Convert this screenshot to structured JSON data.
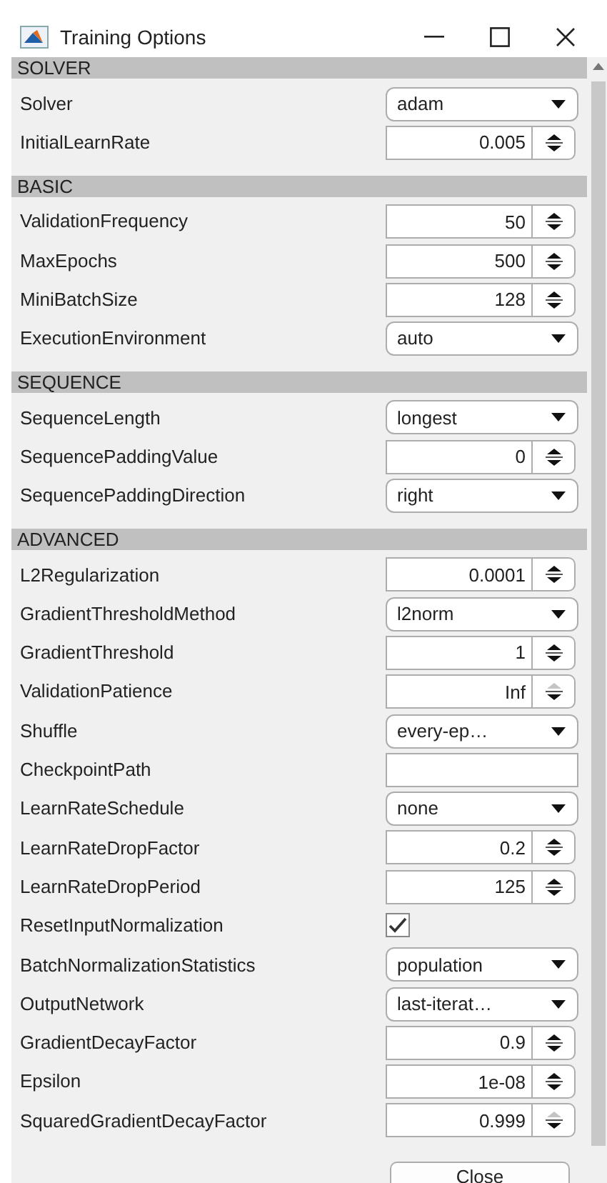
{
  "window": {
    "title": "Training Options"
  },
  "sections": [
    {
      "title": "SOLVER",
      "rows": [
        {
          "label": "Solver",
          "kind": "dropdown",
          "value": "adam"
        },
        {
          "label": "InitialLearnRate",
          "kind": "spinner",
          "value": "0.005",
          "up_disabled": false
        }
      ]
    },
    {
      "title": "BASIC",
      "rows": [
        {
          "label": "ValidationFrequency",
          "kind": "spinner",
          "value": "50",
          "up_disabled": false
        },
        {
          "label": "MaxEpochs",
          "kind": "spinner",
          "value": "500",
          "up_disabled": false
        },
        {
          "label": "MiniBatchSize",
          "kind": "spinner",
          "value": "128",
          "up_disabled": false
        },
        {
          "label": "ExecutionEnvironment",
          "kind": "dropdown",
          "value": "auto"
        }
      ]
    },
    {
      "title": "SEQUENCE",
      "rows": [
        {
          "label": "SequenceLength",
          "kind": "dropdown",
          "value": "longest"
        },
        {
          "label": "SequencePaddingValue",
          "kind": "spinner",
          "value": "0",
          "up_disabled": false
        },
        {
          "label": "SequencePaddingDirection",
          "kind": "dropdown",
          "value": "right"
        }
      ]
    },
    {
      "title": "ADVANCED",
      "rows": [
        {
          "label": "L2Regularization",
          "kind": "spinner",
          "value": "0.0001",
          "up_disabled": false
        },
        {
          "label": "GradientThresholdMethod",
          "kind": "dropdown",
          "value": "l2norm"
        },
        {
          "label": "GradientThreshold",
          "kind": "spinner",
          "value": "1",
          "up_disabled": false
        },
        {
          "label": "ValidationPatience",
          "kind": "spinner",
          "value": "Inf",
          "up_disabled": true
        },
        {
          "label": "Shuffle",
          "kind": "dropdown",
          "value": "every-ep…"
        },
        {
          "label": "CheckpointPath",
          "kind": "text"
        },
        {
          "label": "LearnRateSchedule",
          "kind": "dropdown",
          "value": "none"
        },
        {
          "label": "LearnRateDropFactor",
          "kind": "spinner",
          "value": "0.2",
          "up_disabled": false
        },
        {
          "label": "LearnRateDropPeriod",
          "kind": "spinner",
          "value": "125",
          "up_disabled": false
        },
        {
          "label": "ResetInputNormalization",
          "kind": "checkbox",
          "checked": true
        },
        {
          "label": "BatchNormalizationStatistics",
          "kind": "dropdown",
          "value": "population"
        },
        {
          "label": "OutputNetwork",
          "kind": "dropdown",
          "value": "last-iterat…"
        },
        {
          "label": "GradientDecayFactor",
          "kind": "spinner",
          "value": "0.9",
          "up_disabled": false
        },
        {
          "label": "Epsilon",
          "kind": "spinner",
          "value": "1e-08",
          "up_disabled": false
        },
        {
          "label": "SquaredGradientDecayFactor",
          "kind": "spinner",
          "value": "0.999",
          "up_disabled": true
        }
      ]
    }
  ],
  "close_button": "Close"
}
